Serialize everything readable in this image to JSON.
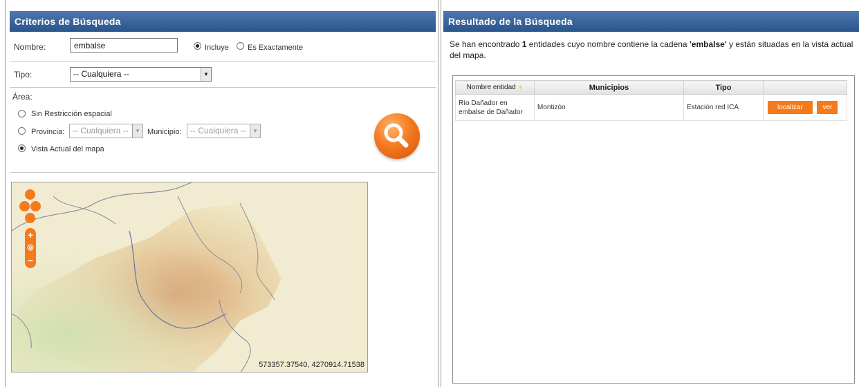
{
  "criteria": {
    "title": "Criterios de Búsqueda",
    "nombre_label": "Nombre:",
    "nombre_value": "embalse",
    "incluye_label": "Incluye",
    "exacto_label": "Es Exactamente",
    "tipo_label": "Tipo:",
    "tipo_value": "-- Cualquiera --",
    "area_label": "Área:",
    "sin_restriccion_label": "Sin Restricción espacial",
    "provincia_label": "Provincia:",
    "provincia_value": "-- Cualquiera --",
    "municipio_label": "Municipio:",
    "municipio_value": "-- Cualquiera --",
    "vista_label": "Vista Actual del mapa",
    "match_mode": "Incluye",
    "area_mode": "Vista Actual del mapa"
  },
  "map": {
    "coordinates": "573357.37540, 4270914.71538",
    "colors": {
      "controls": "#f47a1c",
      "terrain": "#efe9c9",
      "relief": "#c98a55"
    }
  },
  "results": {
    "title": "Resultado de la Búsqueda",
    "msg": {
      "part1": "Se han encontrado ",
      "count": "1",
      "part2": " entidades cuyo nombre contiene la cadena ",
      "query": "'embalse'",
      "part3": " y están situadas en la vista actual del mapa."
    },
    "columns": [
      "Nombre entidad",
      "Municipios",
      "Tipo"
    ],
    "rows": [
      {
        "nombre": "Río Dañador en embalse de Dañador",
        "municipio": "Montizón",
        "tipo": "Estación red ICA",
        "localizar": "localizar",
        "ver": "ver"
      }
    ]
  },
  "colors": {
    "header": "#2a558c",
    "accent": "#f47a1c"
  }
}
